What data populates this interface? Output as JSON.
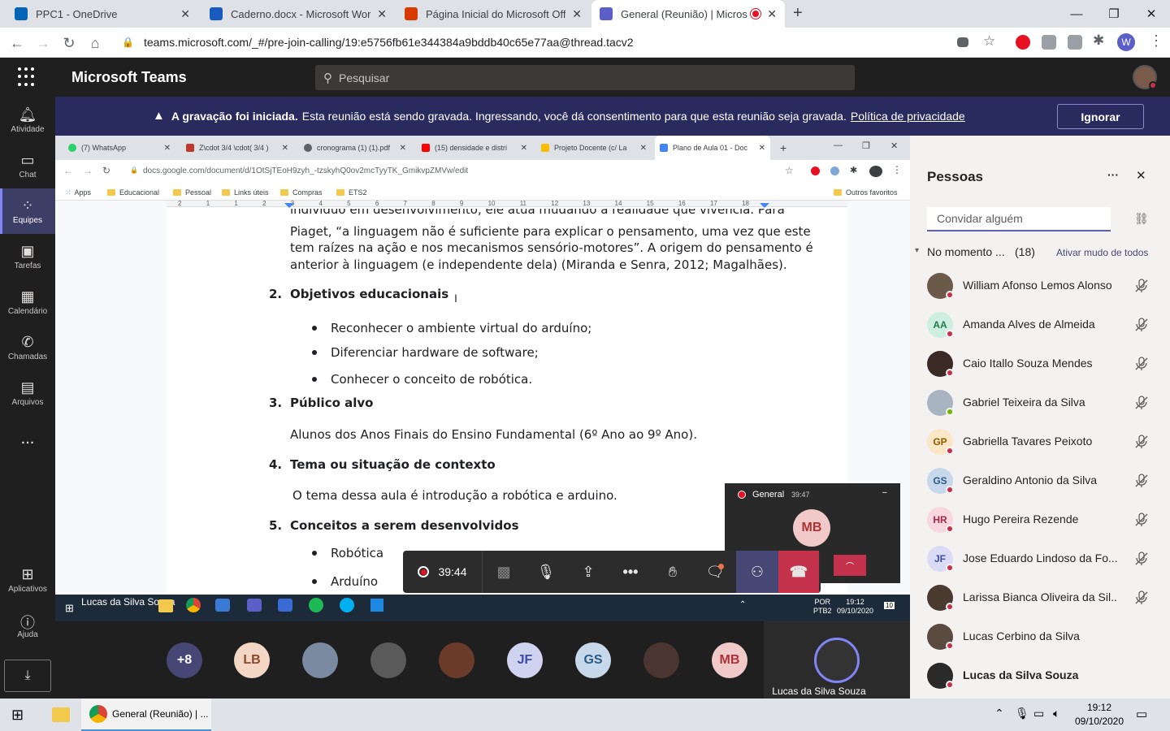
{
  "browser": {
    "tabs": [
      {
        "title": "PPC1 - OneDrive",
        "icon": "onedrive-icon",
        "color": "#0364b8"
      },
      {
        "title": "Caderno.docx - Microsoft Word O",
        "icon": "word-icon",
        "color": "#185abd"
      },
      {
        "title": "Página Inicial do Microsoft Office",
        "icon": "office-icon",
        "color": "#d83b01"
      },
      {
        "title": "General (Reunião) | Microsof",
        "icon": "teams-icon",
        "color": "#5b5fc7"
      }
    ],
    "url": "teams.microsoft.com/_#/pre-join-calling/19:e5756fb61e344384a9bddb40c65e77aa@thread.tacv2",
    "profile_initial": "W"
  },
  "teams": {
    "app_title": "Microsoft Teams",
    "search_placeholder": "Pesquisar",
    "banner": {
      "bold": "A gravação foi iniciada.",
      "text": "Esta reunião está sendo gravada. Ingressando, você dá consentimento para que esta reunião seja gravada.",
      "link": "Política de privacidade",
      "dismiss": "Ignorar"
    },
    "rail": [
      {
        "label": "Atividade",
        "icon": "bell-icon"
      },
      {
        "label": "Chat",
        "icon": "chat-icon"
      },
      {
        "label": "Equipes",
        "icon": "teams-icon"
      },
      {
        "label": "Tarefas",
        "icon": "tasks-icon"
      },
      {
        "label": "Calendário",
        "icon": "calendar-icon"
      },
      {
        "label": "Chamadas",
        "icon": "phone-icon"
      },
      {
        "label": "Arquivos",
        "icon": "files-icon"
      },
      {
        "label": "...",
        "icon": "more-icon"
      }
    ],
    "rail_bottom": [
      {
        "label": "Aplicativos",
        "icon": "apps-icon"
      },
      {
        "label": "Ajuda",
        "icon": "help-icon"
      }
    ]
  },
  "shared_screen": {
    "tabs": [
      {
        "title": "(7) WhatsApp",
        "color": "#25d366"
      },
      {
        "title": "Z\\cdot 3/4 \\cdot( 3/4 )",
        "color": "#c0392b"
      },
      {
        "title": "cronograma (1) (1).pdf",
        "color": "#5f6368"
      },
      {
        "title": "(15) densidade e distri",
        "color": "#ff0000"
      },
      {
        "title": "Projeto Docente (c/ La",
        "color": "#fbbc04"
      },
      {
        "title": "Plano de Aula 01 - Doc",
        "color": "#4285f4"
      }
    ],
    "url": "docs.google.com/document/d/1OtSjTEoH9zyh_-tzskyhQ0ov2mcTyyTK_GmikvpZMVw/edit",
    "bookmarks": [
      "Apps",
      "Educacional",
      "Pessoal",
      "Links úteis",
      "Compras",
      "ETS2"
    ],
    "other_bookmarks": "Outros favoritos",
    "ruler": [
      "2",
      "1",
      "1",
      "2",
      "3",
      "4",
      "5",
      "6",
      "7",
      "8",
      "9",
      "10",
      "11",
      "12",
      "13",
      "14",
      "15",
      "16",
      "17",
      "18"
    ],
    "doc": {
      "line0": "indivíduo em desenvolvimento, ele atua mudando a realidade que vivencia. Para",
      "line1": "Piaget, “a linguagem não é suficiente para explicar o pensamento, uma vez que este",
      "line2": "tem raízes na ação e nos mecanismos sensório-motores”. A origem do pensamento é",
      "line3": "anterior à linguagem (e independente dela) (Miranda e Senra, 2012; Magalhães).",
      "h2n": "2.",
      "h2": "Objetivos educacionais",
      "b1": "Reconhecer o ambiente virtual do arduíno;",
      "b2": "Diferenciar hardware de software;",
      "b3": "Conhecer o conceito de robótica.",
      "h3n": "3.",
      "h3": "Público alvo",
      "p3": "Alunos dos Anos Finais do Ensino Fundamental (6º Ano ao 9º Ano).",
      "h4n": "4.",
      "h4": "Tema ou situação de contexto",
      "p4": "O tema dessa aula é introdução a robótica e arduino.",
      "h5n": "5.",
      "h5": "Conceitos a serem desenvolvidos",
      "b5a": "Robótica",
      "b5b": "Arduíno"
    },
    "taskbar": {
      "user": "Lucas da Silva Souza",
      "lang1": "POR",
      "lang2": "PTB2",
      "time": "19:12",
      "date": "09/10/2020",
      "notif": "10"
    }
  },
  "mini_window": {
    "title": "General",
    "time": "39:47",
    "initials": "MB"
  },
  "controls": {
    "timer": "39:44"
  },
  "strip": {
    "overflow": "+8",
    "avatars": [
      {
        "initials": "LB",
        "bg": "#f3d6c4",
        "fg": "#8a4a2a"
      },
      {
        "initials": "",
        "bg": "#7a8aa0",
        "fg": "#fff",
        "photo": true
      },
      {
        "initials": "",
        "bg": "#5a5a5a",
        "fg": "#fff",
        "photo": true
      },
      {
        "initials": "",
        "bg": "#6b3b2a",
        "fg": "#fff",
        "photo": true
      },
      {
        "initials": "JF",
        "bg": "#cfd3ef",
        "fg": "#3b4ba8"
      },
      {
        "initials": "GS",
        "bg": "#c7d8ea",
        "fg": "#2c5a85"
      },
      {
        "initials": "",
        "bg": "#4a3530",
        "fg": "#fff",
        "photo": true
      },
      {
        "initials": "MB",
        "bg": "#f2c9c9",
        "fg": "#a33"
      }
    ],
    "self_name": "Lucas da Silva Souza"
  },
  "people": {
    "title": "Pessoas",
    "invite_placeholder": "Convidar alguém",
    "section": "No momento ...",
    "count": "(18)",
    "mute_all": "Ativar mudo de todos",
    "list": [
      {
        "name": "William Afonso Lemos Alonso",
        "initials": "",
        "bg": "#6b5a4a",
        "fg": "#fff",
        "status": "#c4314b",
        "muted": true
      },
      {
        "name": "Amanda Alves de Almeida",
        "initials": "AA",
        "bg": "#cdeee0",
        "fg": "#237b4b",
        "status": "#c4314b",
        "muted": true
      },
      {
        "name": "Caio Itallo Souza Mendes",
        "initials": "",
        "bg": "#3a2a25",
        "fg": "#fff",
        "status": "#c4314b",
        "muted": true
      },
      {
        "name": "Gabriel Teixeira da Silva",
        "initials": "",
        "bg": "#a8b4c0",
        "fg": "#fff",
        "status": "#6bb700",
        "muted": true
      },
      {
        "name": "Gabriella Tavares Peixoto",
        "initials": "GP",
        "bg": "#fbe7c6",
        "fg": "#8f5b00",
        "status": "#c4314b",
        "muted": true
      },
      {
        "name": "Geraldino Antonio da Silva",
        "initials": "GS",
        "bg": "#c7d8ea",
        "fg": "#2c5a85",
        "status": "#c4314b",
        "muted": true
      },
      {
        "name": "Hugo Pereira Rezende",
        "initials": "HR",
        "bg": "#f8d7e0",
        "fg": "#a3294a",
        "status": "#c4314b",
        "muted": true
      },
      {
        "name": "Jose Eduardo Lindoso da Fo...",
        "initials": "JF",
        "bg": "#dadcf5",
        "fg": "#3b4ba8",
        "status": "#c4314b",
        "muted": true
      },
      {
        "name": "Larissa Bianca Oliveira da Sil...",
        "initials": "",
        "bg": "#4a3a30",
        "fg": "#fff",
        "status": "#c4314b",
        "muted": true
      },
      {
        "name": "Lucas Cerbino da Silva",
        "initials": "",
        "bg": "#5a4a40",
        "fg": "#fff",
        "status": "#c4314b",
        "muted": false
      },
      {
        "name": "Lucas da Silva Souza",
        "initials": "",
        "bg": "#2a2a2a",
        "fg": "#fff",
        "status": "#c4314b",
        "muted": false,
        "bold": true
      }
    ]
  },
  "taskbar": {
    "app_title": "General (Reunião) | ...",
    "time": "19:12",
    "date": "09/10/2020"
  },
  "colors": {
    "teams_purple": "#464775",
    "hangup": "#c4314b",
    "record": "#e81123"
  }
}
